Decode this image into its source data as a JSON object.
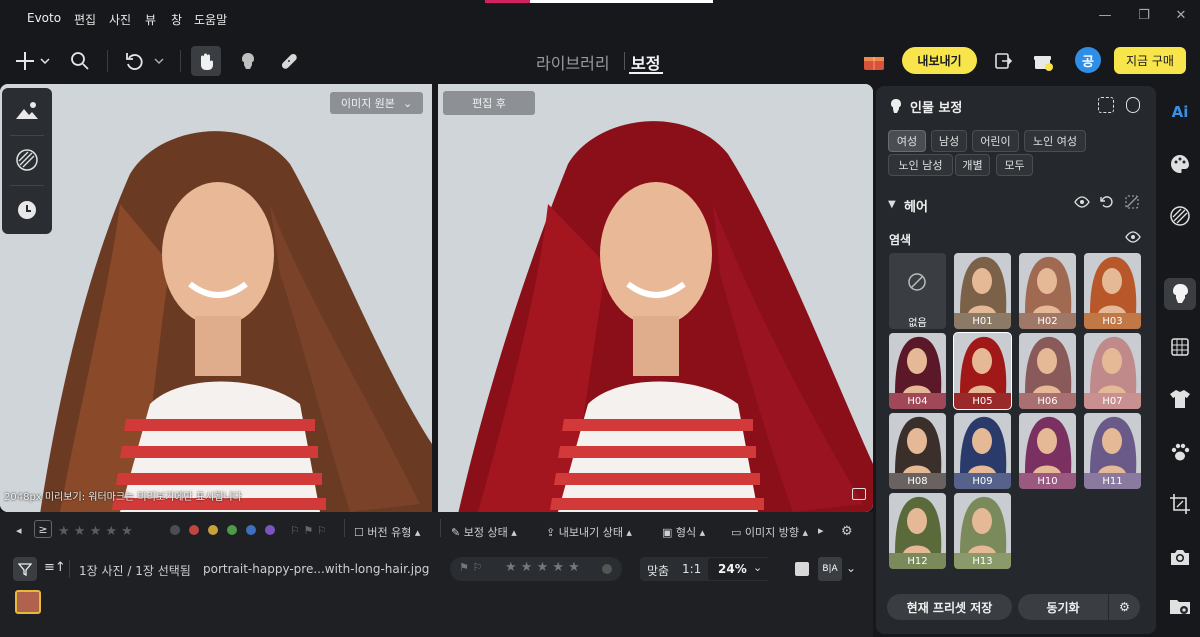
{
  "app": {
    "title": "Evoto"
  },
  "menu": {
    "items": [
      "편집",
      "사진",
      "뷰",
      "창",
      "도움말"
    ]
  },
  "toolbar": {
    "tab_library": "라이브러리",
    "tab_edit": "보정",
    "export": "내보내기",
    "avatar": "공",
    "buy": "지금 구매"
  },
  "canvas": {
    "original_chip": "이미지 원본",
    "after_chip": "편집 후",
    "watermark": "2048px 미리보기: 워터마크는 미리보기에만 표시됩니다"
  },
  "ribbon": {
    "ge": "≥",
    "version": "버전 유형",
    "correction": "보정 상태",
    "export": "내보내기 상태",
    "format": "형식",
    "orientation": "이미지 방향",
    "colors": [
      "#4b4e52",
      "#c0453c",
      "#c9a23a",
      "#4f9a48",
      "#3f6fbf",
      "#7a55c0"
    ]
  },
  "filebar": {
    "count": "1장 사진 / 1장 선택됨",
    "filename": "portrait-happy-pre...with-long-hair.jpg",
    "fit": "맞춤",
    "one": "1:1",
    "zoom": "24%"
  },
  "panel": {
    "title": "인물 보정",
    "groups": [
      {
        "label": "여성",
        "selected": true
      },
      {
        "label": "남성",
        "selected": false
      },
      {
        "label": "어린이",
        "selected": false
      },
      {
        "label": "노인 여성",
        "selected": false
      },
      {
        "label": "노인 남성",
        "selected": false
      },
      {
        "label": "개별",
        "selected": false
      },
      {
        "label": "모두",
        "selected": false
      }
    ],
    "section": "헤어",
    "subsection": "염색",
    "swatches": [
      {
        "label": "없음",
        "hair": "none",
        "bar": "#3a3d42"
      },
      {
        "label": "H01",
        "hair": "#7a6148",
        "bar": "#8a7a66"
      },
      {
        "label": "H02",
        "hair": "#a06a52",
        "bar": "#a07868"
      },
      {
        "label": "H03",
        "hair": "#b8582a",
        "bar": "#c07846"
      },
      {
        "label": "H04",
        "hair": "#5a1828",
        "bar": "#a04858"
      },
      {
        "label": "H05",
        "hair": "#a01818",
        "bar": "#9a2a2a"
      },
      {
        "label": "H06",
        "hair": "#8a5a5a",
        "bar": "#a87070"
      },
      {
        "label": "H07",
        "hair": "#c08a8a",
        "bar": "#c89090"
      },
      {
        "label": "H08",
        "hair": "#3a2f2a",
        "bar": "#6a6260"
      },
      {
        "label": "H09",
        "hair": "#2a3a6a",
        "bar": "#56628a"
      },
      {
        "label": "H10",
        "hair": "#7a3060",
        "bar": "#9a5a80"
      },
      {
        "label": "H11",
        "hair": "#6a5a8a",
        "bar": "#8a7aa0"
      },
      {
        "label": "H12",
        "hair": "#5a6a3a",
        "bar": "#7a8a5a"
      },
      {
        "label": "H13",
        "hair": "#7a8a5a",
        "bar": "#8a9a6a"
      }
    ],
    "save_preset": "현재 프리셋 저장",
    "sync": "동기화"
  }
}
